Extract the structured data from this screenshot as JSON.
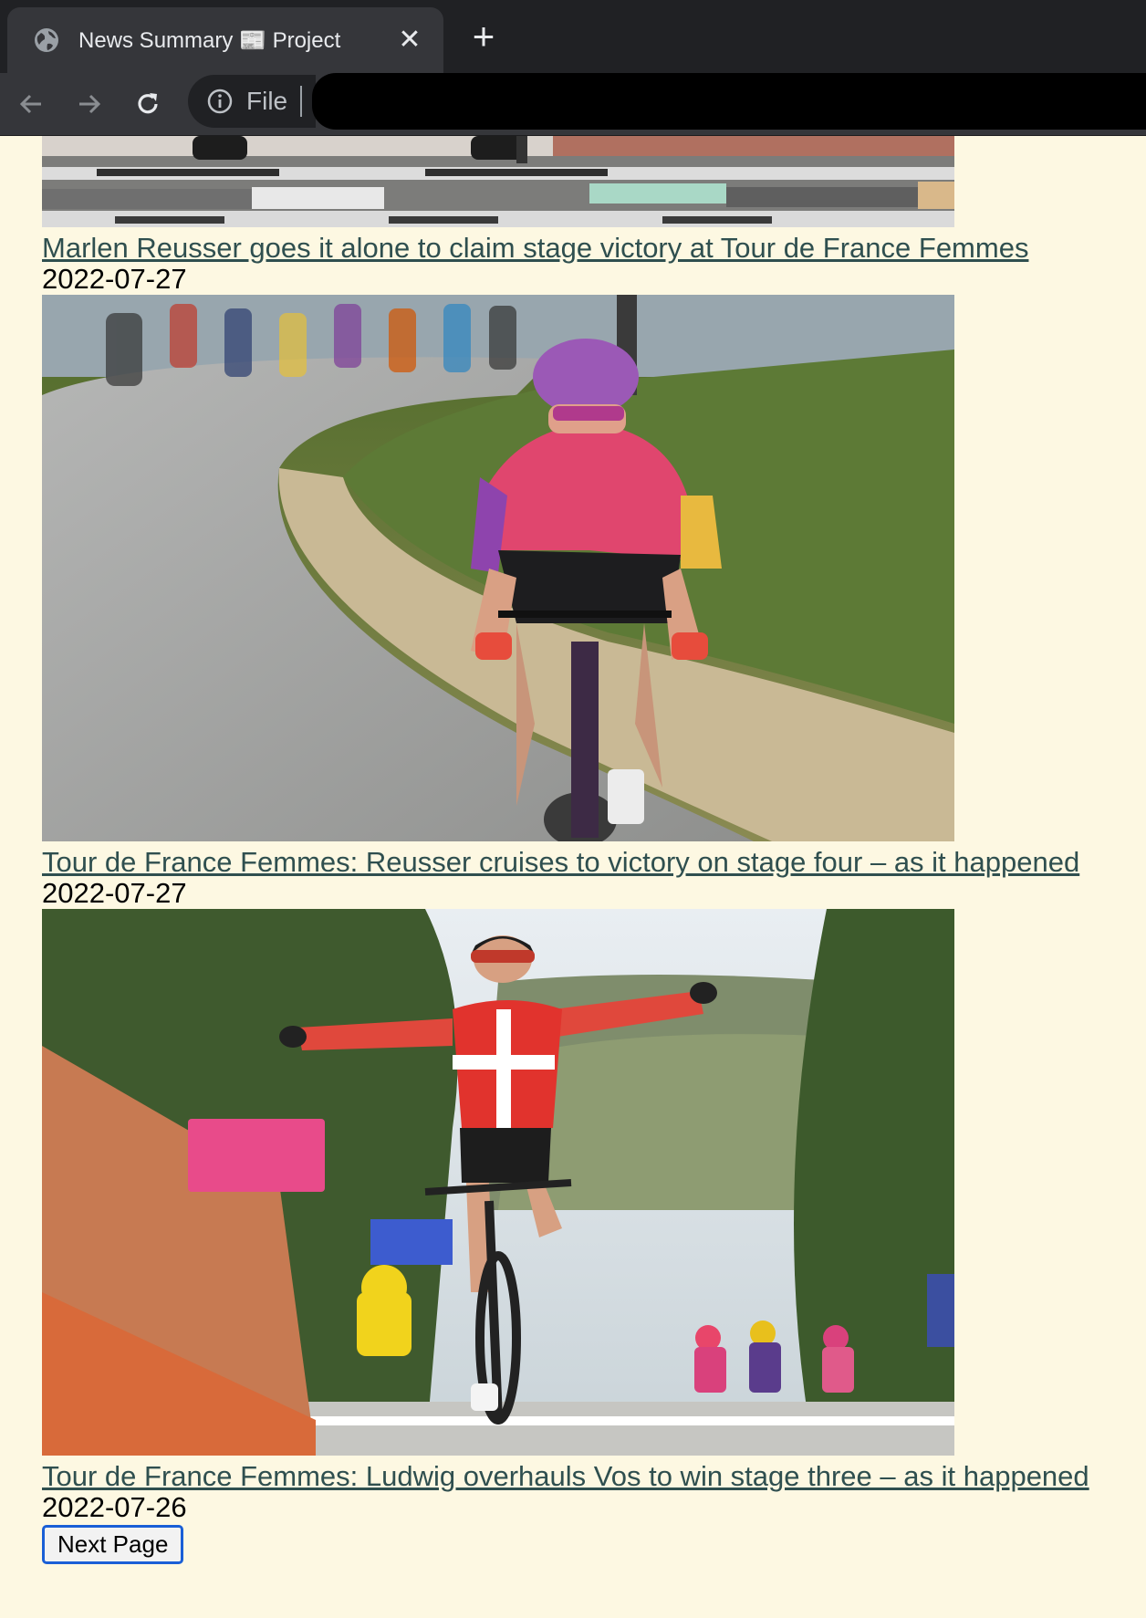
{
  "browser": {
    "tab_title": "News Summary 📰 Project",
    "close_glyph": "✕",
    "new_tab_glyph": "+",
    "address_label": "File"
  },
  "articles": [
    {
      "headline": "Marlen Reusser goes it alone to claim stage victory at Tour de France Femmes",
      "date": "2022-07-27",
      "image": "road finish line photo"
    },
    {
      "headline": "Tour de France Femmes: Reusser cruises to victory on stage four – as it happened",
      "date": "2022-07-27",
      "image": "cyclist in pink and purple climbing road"
    },
    {
      "headline": "Tour de France Femmes: Ludwig overhauls Vos to win stage three – as it happened",
      "date": "2022-07-26",
      "image": "cyclist celebrating at finish line in red and white jersey"
    }
  ],
  "pagination": {
    "next_label": "Next Page"
  },
  "colors": {
    "page_bg": "#fdf8e2",
    "link": "#2f4f4f",
    "button_border": "#1a5fd6"
  }
}
